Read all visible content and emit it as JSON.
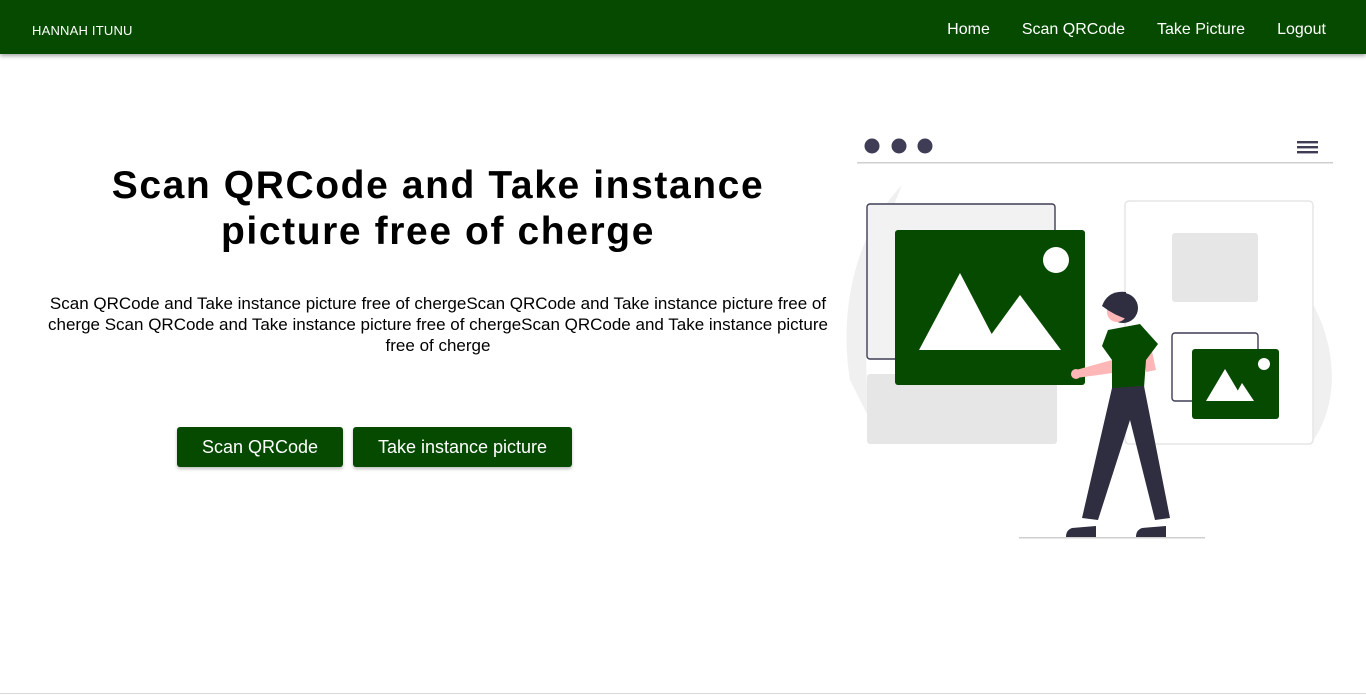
{
  "nav": {
    "brand": "HANNAH ITUNU",
    "links": [
      "Home",
      "Scan QRCode",
      "Take Picture",
      "Logout"
    ]
  },
  "hero": {
    "title": "Scan QRCode and Take instance picture free of cherge",
    "description": "Scan QRCode and Take instance picture free of chergeScan QRCode and Take instance picture free of cherge Scan QRCode and Take instance picture free of chergeScan QRCode and Take instance picture free of cherge",
    "buttons": {
      "scan": "Scan QRCode",
      "take": "Take instance picture"
    }
  },
  "theme": {
    "accent": "#064a00",
    "illustration_dark": "#2f2e41",
    "skin": "#ffb6b6"
  },
  "icons": [
    "hamburger-menu-icon",
    "image-placeholder-icon"
  ]
}
